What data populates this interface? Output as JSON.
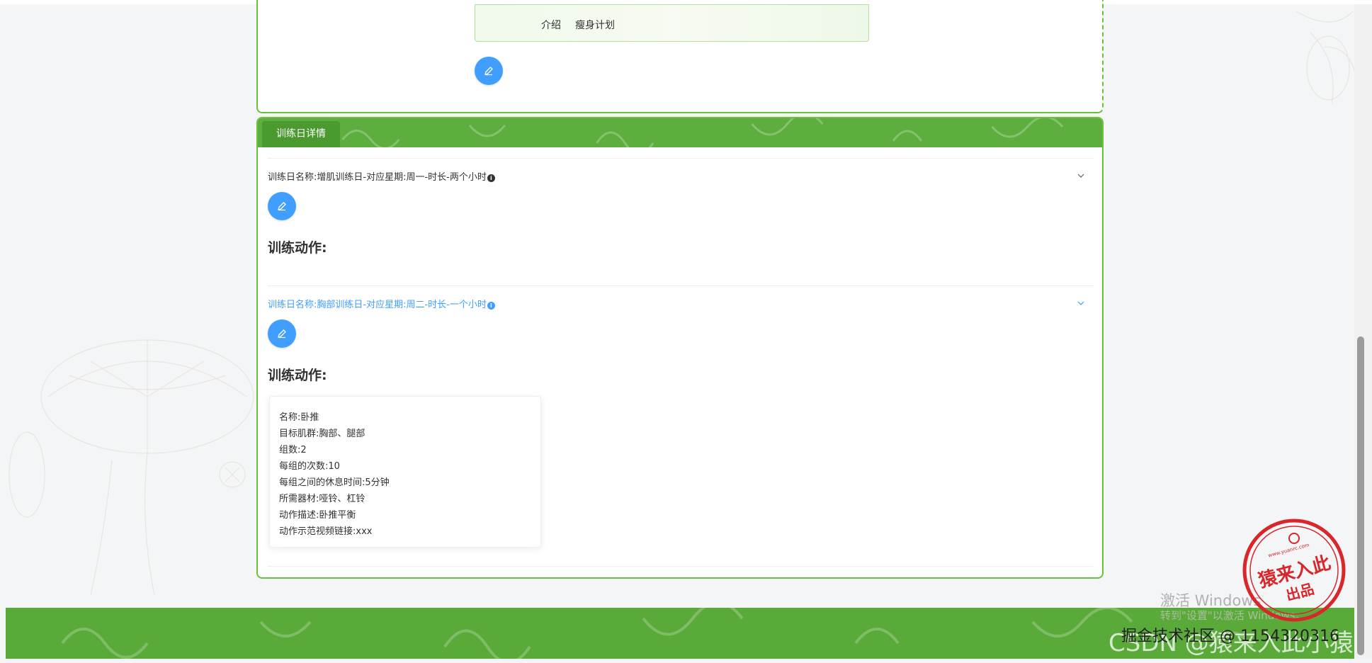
{
  "plan": {
    "intro_label": "介绍",
    "intro_value": "瘦身计划"
  },
  "days_panel": {
    "tab_label": "训练日详情",
    "days": [
      {
        "title": "训练日名称:增肌训练日-对应星期:周一-时长-两个小时",
        "section_heading": "训练动作:"
      },
      {
        "title": "训练日名称:胸部训练日-对应星期:周二-时长-一个小时",
        "section_heading": "训练动作:",
        "action": {
          "name": "名称:卧推",
          "target": "目标肌群:胸部、腿部",
          "sets": "组数:2",
          "reps": "每组的次数:10",
          "rest": "每组之间的休息时间:5分钟",
          "equipment": "所需器材:哑铃、杠铃",
          "description": "动作描述:卧推平衡",
          "video": "动作示范视频链接:xxx"
        }
      }
    ]
  },
  "watermarks": {
    "windows": "激活 Windows",
    "windows_sub": "转到\"设置\"以激活 Windows。",
    "csdn": "CSDN @猿来入此小猿",
    "juejin": "掘金技术社区 @ 1154320316"
  },
  "seal": {
    "text_main": "猿来入此",
    "text_sub": "出品",
    "url": "www.yuanrc.com"
  },
  "colors": {
    "primary_green": "#67c23a",
    "header_green": "#5dae3e",
    "button_blue": "#409eff",
    "seal_red": "#d8262b"
  },
  "icons": {
    "edit": "pencil-icon",
    "info": "info-icon",
    "expand": "chevron-down-icon"
  }
}
